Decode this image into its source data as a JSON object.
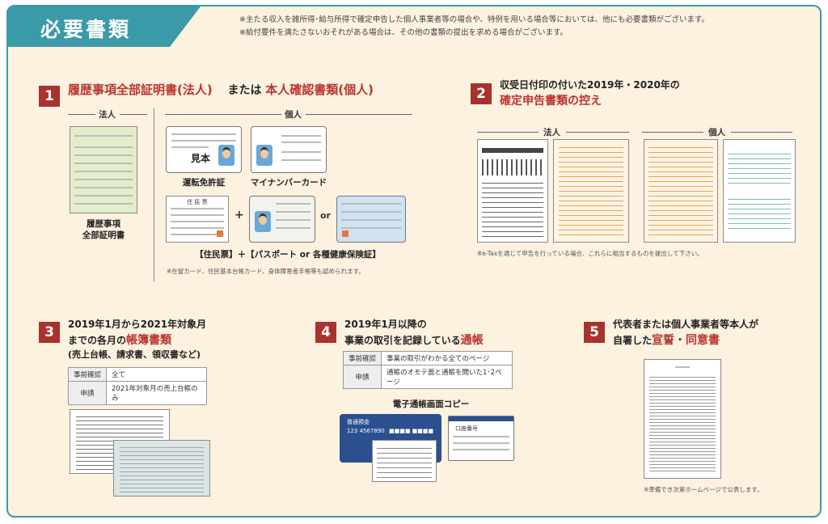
{
  "header": {
    "title": "必要書類",
    "note1": "※主たる収入を雑所得･給与所得で確定申告した個人事業者等の場合や、特例を用いる場合等においては、他にも必要書類がございます。",
    "note2": "※給付要件を満たさないおそれがある場合は、その他の書類の提出を求める場合がございます。"
  },
  "s1": {
    "num": "1",
    "title_a": "履歴事項全部証明書(法人)",
    "title_or": "または",
    "title_b": "本人確認書類(個人)",
    "corp_label": "法人",
    "indiv_label": "個人",
    "corp_doc_caption": "履歴事項\n全部証明書",
    "license_caption": "運転免許証",
    "mynumber_caption": "マイナンバーカード",
    "plus": "+",
    "or": "or",
    "combo_caption": "【住民票】＋【パスポート or 各種健康保険証】",
    "note": "※在留カード、住民基本台帳カード、身体障害者手帳等も認められます。",
    "license_stamp": "見本",
    "juminhyo_title": "住 民 票"
  },
  "s2": {
    "num": "2",
    "title_a": "収受日付印の付いた2019年・2020年の",
    "title_b": "確定申告書類の控え",
    "corp_label": "法人",
    "indiv_label": "個人",
    "note": "※e-Taxを通じて申告を行っている場合、これらに相当するものを提出して下さい。"
  },
  "s3": {
    "num": "3",
    "title_a": "2019年1月から2021年対象月",
    "title_b": "までの各月の",
    "title_red": "帳簿書類",
    "title_c": "(売上台帳、請求書、領収書など)",
    "table": [
      {
        "head": "事前確認",
        "value": "全て"
      },
      {
        "head": "申請",
        "value": "2021年対象月の売上台帳のみ"
      }
    ]
  },
  "s4": {
    "num": "4",
    "title_a": "2019年1月以降の",
    "title_b": "事業の取引を記録している",
    "title_red": "通帳",
    "table": [
      {
        "head": "事前確認",
        "value": "事業の取引がわかる全てのページ"
      },
      {
        "head": "申請",
        "value": "通帳のオモテ面と通帳を開いた1･2ページ"
      }
    ],
    "ebank_caption": "電子通帳画面コピー",
    "passbook_label": "普通預金",
    "passbook_number": "123 4567890",
    "passbook_name": "■■■■ ■■■■",
    "screen_label": "口座番号"
  },
  "s5": {
    "num": "5",
    "title_a": "代表者または個人事業者等本人が",
    "title_b": "自署した",
    "title_red": "宣誓・同意書",
    "note": "※準備でき次第ホームページで公表します。"
  }
}
